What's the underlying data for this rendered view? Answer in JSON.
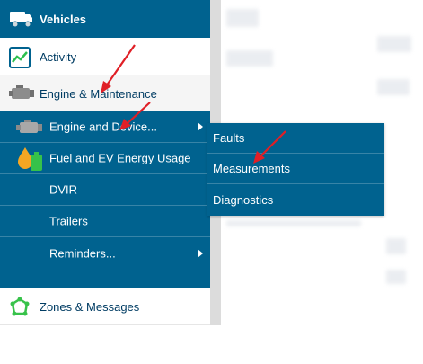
{
  "sidebar": {
    "vehicles_label": "Vehicles",
    "activity_label": "Activity",
    "engine_label": "Engine & Maintenance",
    "zones_label": "Zones & Messages"
  },
  "submenu": {
    "items": [
      {
        "label": "Engine and Device..."
      },
      {
        "label": "Fuel and EV Energy Usage"
      },
      {
        "label": "DVIR"
      },
      {
        "label": "Trailers"
      },
      {
        "label": "Reminders..."
      }
    ]
  },
  "flyout": {
    "items": [
      {
        "label": "Faults"
      },
      {
        "label": "Measurements"
      },
      {
        "label": "Diagnostics"
      }
    ]
  },
  "colors": {
    "nav_blue": "#00628f",
    "text_blue": "#003c63",
    "annotation_red": "#e01f26"
  }
}
